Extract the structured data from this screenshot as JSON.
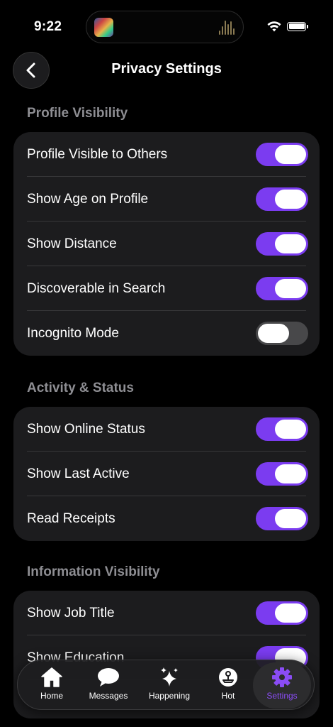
{
  "status_bar": {
    "time": "9:22"
  },
  "header": {
    "title": "Privacy Settings"
  },
  "sections": [
    {
      "title": "Profile Visibility",
      "items": [
        {
          "label": "Profile Visible to Others",
          "enabled": true
        },
        {
          "label": "Show Age on Profile",
          "enabled": true
        },
        {
          "label": "Show Distance",
          "enabled": true
        },
        {
          "label": "Discoverable in Search",
          "enabled": true
        },
        {
          "label": "Incognito Mode",
          "enabled": false
        }
      ]
    },
    {
      "title": "Activity & Status",
      "items": [
        {
          "label": "Show Online Status",
          "enabled": true
        },
        {
          "label": "Show Last Active",
          "enabled": true
        },
        {
          "label": "Read Receipts",
          "enabled": true
        }
      ]
    },
    {
      "title": "Information Visibility",
      "items": [
        {
          "label": "Show Job Title",
          "enabled": true
        },
        {
          "label": "Show Education",
          "enabled": true
        }
      ]
    }
  ],
  "tab_bar": {
    "tabs": [
      {
        "label": "Home",
        "icon": "home-icon",
        "active": false
      },
      {
        "label": "Messages",
        "icon": "chat-bubble-icon",
        "active": false
      },
      {
        "label": "Happening",
        "icon": "sparkles-icon",
        "active": false
      },
      {
        "label": "Hot",
        "icon": "joystick-icon",
        "active": false
      },
      {
        "label": "Settings",
        "icon": "gear-icon",
        "active": true
      }
    ]
  },
  "colors": {
    "accent": "#7b3cf0",
    "background": "#000000",
    "card": "#1c1c1e",
    "section_header": "#8e8e93",
    "toggle_off": "#48484a"
  }
}
